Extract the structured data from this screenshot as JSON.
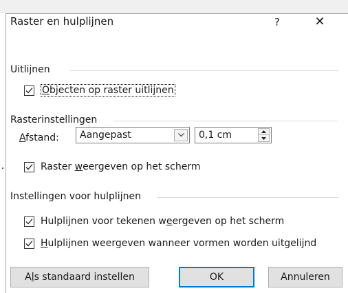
{
  "dialog": {
    "title": "Raster en hulplijnen",
    "help": "?",
    "close": "✕"
  },
  "align": {
    "heading": "Uitlijnen",
    "snap_to_grid": {
      "checked": true,
      "label_u": "O",
      "label_rest": "bjecten op raster uitlijnen"
    }
  },
  "grid": {
    "heading": "Rasterinstellingen",
    "spacing_label_u": "A",
    "spacing_label_rest": "fstand:",
    "spacing_preset": "Aangepast",
    "spacing_value": "0,1 cm",
    "show_grid": {
      "checked": true,
      "label_a": "Raster ",
      "label_u": "w",
      "label_b": "eergeven op het scherm"
    }
  },
  "guides": {
    "heading": "Instellingen voor hulplijnen",
    "show_drawing_guides": {
      "checked": true,
      "label_a": "Hulplijnen voor tekenen w",
      "label_u": "e",
      "label_b": "ergeven op het scherm"
    },
    "show_smart_guides": {
      "checked": true,
      "label_u": "H",
      "label_rest": "ulplijnen weergeven wanneer vormen worden uitgelijnd"
    }
  },
  "buttons": {
    "default_a": "A",
    "default_u": "l",
    "default_b": "s standaard instellen",
    "ok": "OK",
    "cancel": "Annuleren"
  },
  "colors": {
    "focus_border": "#0078d7",
    "button_bg": "#e1e1e1"
  }
}
